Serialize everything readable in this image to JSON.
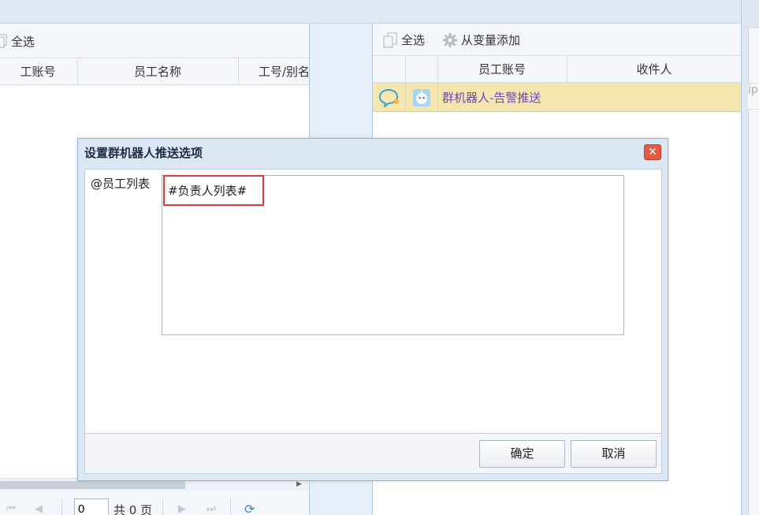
{
  "left_panel": {
    "toolbar": {
      "select_all": "全选"
    },
    "columns": [
      "工账号",
      "员工名称",
      "工号/别名"
    ],
    "pager": {
      "page_value": "0",
      "total": "共 0 页"
    }
  },
  "right_panel": {
    "toolbar": {
      "select_all": "全选",
      "add_from_variable": "从变量添加"
    },
    "columns": [
      "员工账号",
      "收件人"
    ],
    "rows": [
      {
        "name": "群机器人-告警推送"
      }
    ]
  },
  "edge_strip": {
    "cell_text": "ip"
  },
  "dialog": {
    "title": "设置群机器人推送选项",
    "close": "✕",
    "field_label": "@员工列表",
    "field_value": "#负责人列表#",
    "ok": "确定",
    "cancel": "取消"
  },
  "colors": {
    "highlight_border": "#e03a3a",
    "row_selected": "#f5e6b0",
    "link_text": "#6a44c8",
    "close_button": "#e25b44"
  }
}
